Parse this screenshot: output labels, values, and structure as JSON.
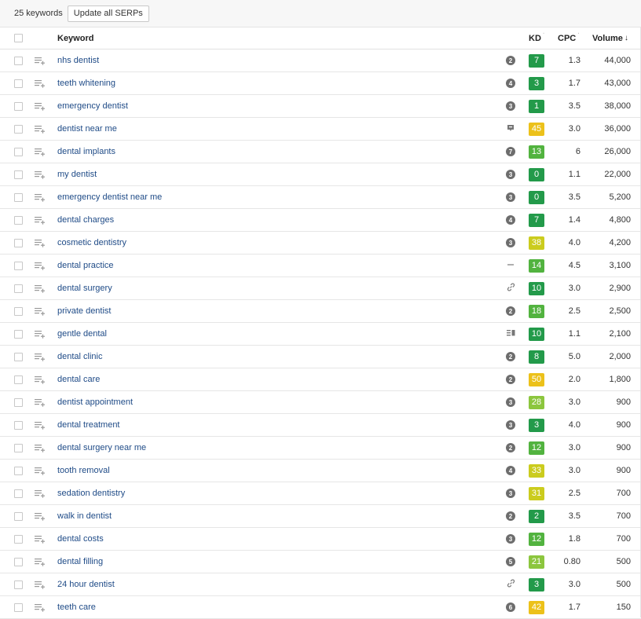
{
  "toolbar": {
    "count": "25 keywords",
    "update_label": "Update all SERPs"
  },
  "header": {
    "keyword": "Keyword",
    "kd": "KD",
    "cpc": "CPC",
    "volume": "Volume",
    "tick": "ˈ",
    "sort_arrow": "↓"
  },
  "colors": {
    "dark_green": "#239a4a",
    "green": "#52b33f",
    "light_green": "#8cc63e",
    "yellow_green": "#cbcc1e",
    "yellow": "#ecc11a",
    "link": "#1f4b87"
  },
  "rows": [
    {
      "keyword": "nhs dentist",
      "serp": {
        "type": "number",
        "value": "2"
      },
      "kd": "7",
      "kd_color": "#239a4a",
      "cpc": "1.3",
      "volume": "44,000"
    },
    {
      "keyword": "teeth whitening",
      "serp": {
        "type": "number",
        "value": "4"
      },
      "kd": "3",
      "kd_color": "#239a4a",
      "cpc": "1.7",
      "volume": "43,000"
    },
    {
      "keyword": "emergency dentist",
      "serp": {
        "type": "number",
        "value": "3"
      },
      "kd": "1",
      "kd_color": "#239a4a",
      "cpc": "3.5",
      "volume": "38,000"
    },
    {
      "keyword": "dentist near me",
      "serp": {
        "type": "icon",
        "icon": "map-pin-icon"
      },
      "kd": "45",
      "kd_color": "#ecc11a",
      "cpc": "3.0",
      "volume": "36,000"
    },
    {
      "keyword": "dental implants",
      "serp": {
        "type": "number",
        "value": "7"
      },
      "kd": "13",
      "kd_color": "#52b33f",
      "cpc": "6",
      "volume": "26,000"
    },
    {
      "keyword": "my dentist",
      "serp": {
        "type": "number",
        "value": "3"
      },
      "kd": "0",
      "kd_color": "#239a4a",
      "cpc": "1.1",
      "volume": "22,000"
    },
    {
      "keyword": "emergency dentist near me",
      "serp": {
        "type": "number",
        "value": "3"
      },
      "kd": "0",
      "kd_color": "#239a4a",
      "cpc": "3.5",
      "volume": "5,200"
    },
    {
      "keyword": "dental charges",
      "serp": {
        "type": "number",
        "value": "4"
      },
      "kd": "7",
      "kd_color": "#239a4a",
      "cpc": "1.4",
      "volume": "4,800"
    },
    {
      "keyword": "cosmetic dentistry",
      "serp": {
        "type": "number",
        "value": "3"
      },
      "kd": "38",
      "kd_color": "#cbcc1e",
      "cpc": "4.0",
      "volume": "4,200"
    },
    {
      "keyword": "dental practice",
      "serp": {
        "type": "icon",
        "icon": "dash-icon"
      },
      "kd": "14",
      "kd_color": "#52b33f",
      "cpc": "4.5",
      "volume": "3,100"
    },
    {
      "keyword": "dental surgery",
      "serp": {
        "type": "icon",
        "icon": "link-icon"
      },
      "kd": "10",
      "kd_color": "#239a4a",
      "cpc": "3.0",
      "volume": "2,900"
    },
    {
      "keyword": "private dentist",
      "serp": {
        "type": "number",
        "value": "2"
      },
      "kd": "18",
      "kd_color": "#52b33f",
      "cpc": "2.5",
      "volume": "2,500"
    },
    {
      "keyword": "gentle dental",
      "serp": {
        "type": "icon",
        "icon": "knowledge-panel-icon"
      },
      "kd": "10",
      "kd_color": "#239a4a",
      "cpc": "1.1",
      "volume": "2,100"
    },
    {
      "keyword": "dental clinic",
      "serp": {
        "type": "number",
        "value": "2"
      },
      "kd": "8",
      "kd_color": "#239a4a",
      "cpc": "5.0",
      "volume": "2,000"
    },
    {
      "keyword": "dental care",
      "serp": {
        "type": "number",
        "value": "2"
      },
      "kd": "50",
      "kd_color": "#ecc11a",
      "cpc": "2.0",
      "volume": "1,800"
    },
    {
      "keyword": "dentist appointment",
      "serp": {
        "type": "number",
        "value": "3"
      },
      "kd": "28",
      "kd_color": "#8cc63e",
      "cpc": "3.0",
      "volume": "900"
    },
    {
      "keyword": "dental treatment",
      "serp": {
        "type": "number",
        "value": "3"
      },
      "kd": "3",
      "kd_color": "#239a4a",
      "cpc": "4.0",
      "volume": "900"
    },
    {
      "keyword": "dental surgery near me",
      "serp": {
        "type": "number",
        "value": "2"
      },
      "kd": "12",
      "kd_color": "#52b33f",
      "cpc": "3.0",
      "volume": "900"
    },
    {
      "keyword": "tooth removal",
      "serp": {
        "type": "number",
        "value": "4"
      },
      "kd": "33",
      "kd_color": "#cbcc1e",
      "cpc": "3.0",
      "volume": "900"
    },
    {
      "keyword": "sedation dentistry",
      "serp": {
        "type": "number",
        "value": "3"
      },
      "kd": "31",
      "kd_color": "#cbcc1e",
      "cpc": "2.5",
      "volume": "700"
    },
    {
      "keyword": "walk in dentist",
      "serp": {
        "type": "number",
        "value": "2"
      },
      "kd": "2",
      "kd_color": "#239a4a",
      "cpc": "3.5",
      "volume": "700"
    },
    {
      "keyword": "dental costs",
      "serp": {
        "type": "number",
        "value": "3"
      },
      "kd": "12",
      "kd_color": "#52b33f",
      "cpc": "1.8",
      "volume": "700"
    },
    {
      "keyword": "dental filling",
      "serp": {
        "type": "number",
        "value": "5"
      },
      "kd": "21",
      "kd_color": "#8cc63e",
      "cpc": "0.80",
      "volume": "500"
    },
    {
      "keyword": "24 hour dentist",
      "serp": {
        "type": "icon",
        "icon": "link-icon"
      },
      "kd": "3",
      "kd_color": "#239a4a",
      "cpc": "3.0",
      "volume": "500"
    },
    {
      "keyword": "teeth care",
      "serp": {
        "type": "number",
        "value": "6"
      },
      "kd": "42",
      "kd_color": "#ecc11a",
      "cpc": "1.7",
      "volume": "150"
    }
  ]
}
